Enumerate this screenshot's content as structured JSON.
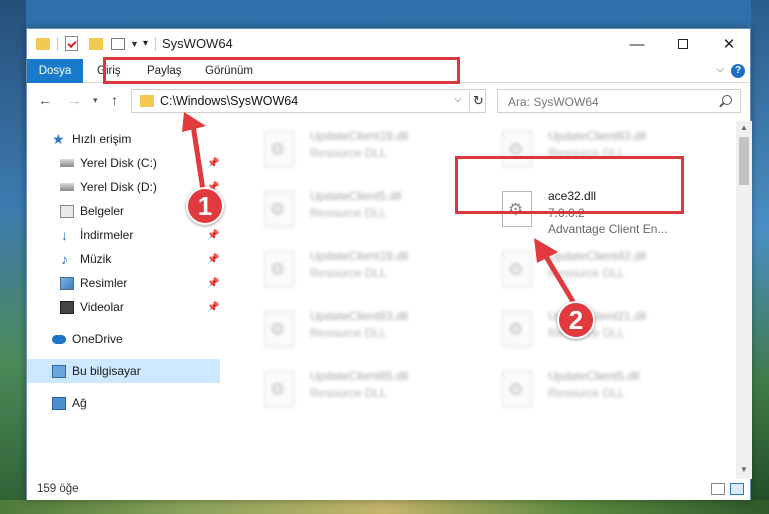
{
  "window": {
    "title": "SysWOW64"
  },
  "ribbon": {
    "tabs": [
      {
        "label": "Dosya"
      },
      {
        "label": "Giriş"
      },
      {
        "label": "Paylaş"
      },
      {
        "label": "Görünüm"
      }
    ],
    "help": "?"
  },
  "nav": {
    "address": "C:\\Windows\\SysWOW64",
    "search_placeholder": "Ara: SysWOW64"
  },
  "sidebar": {
    "items": [
      {
        "label": "Hızlı erişim"
      },
      {
        "label": "Yerel Disk (C:)"
      },
      {
        "label": "Yerel Disk (D:)"
      },
      {
        "label": "Belgeler"
      },
      {
        "label": "İndirmeler"
      },
      {
        "label": "Müzik"
      },
      {
        "label": "Resimler"
      },
      {
        "label": "Videolar"
      },
      {
        "label": "OneDrive"
      },
      {
        "label": "Bu bilgisayar"
      },
      {
        "label": "Ağ"
      }
    ]
  },
  "files": [
    {
      "name": "UpdateClient19.dll",
      "desc": "Resource DLL"
    },
    {
      "name": "UpdateClient63.dll",
      "desc": "Resource DLL"
    },
    {
      "name": "UpdateClient5.dll",
      "desc": "Resource DLL"
    },
    {
      "name": "ace32.dll",
      "desc": "7.0.0.2",
      "tag": "Advantage Client En..."
    },
    {
      "name": "UpdateClient19.dll",
      "desc": "Resource DLL"
    },
    {
      "name": "UpdateClient42.dll",
      "desc": "Resource DLL"
    },
    {
      "name": "UpdateClient63.dll",
      "desc": "Resource DLL"
    },
    {
      "name": "UpdateClient21.dll",
      "desc": "Resource DLL"
    },
    {
      "name": "UpdateClient65.dll",
      "desc": "Resource DLL"
    },
    {
      "name": "UpdateClient5.dll",
      "desc": "Resource DLL"
    }
  ],
  "status": {
    "count": "159 öğe"
  },
  "callouts": {
    "one": "1",
    "two": "2"
  },
  "colors": {
    "accent": "#1979ca",
    "highlight": "#d9373b",
    "selection": "#cde8ff"
  }
}
